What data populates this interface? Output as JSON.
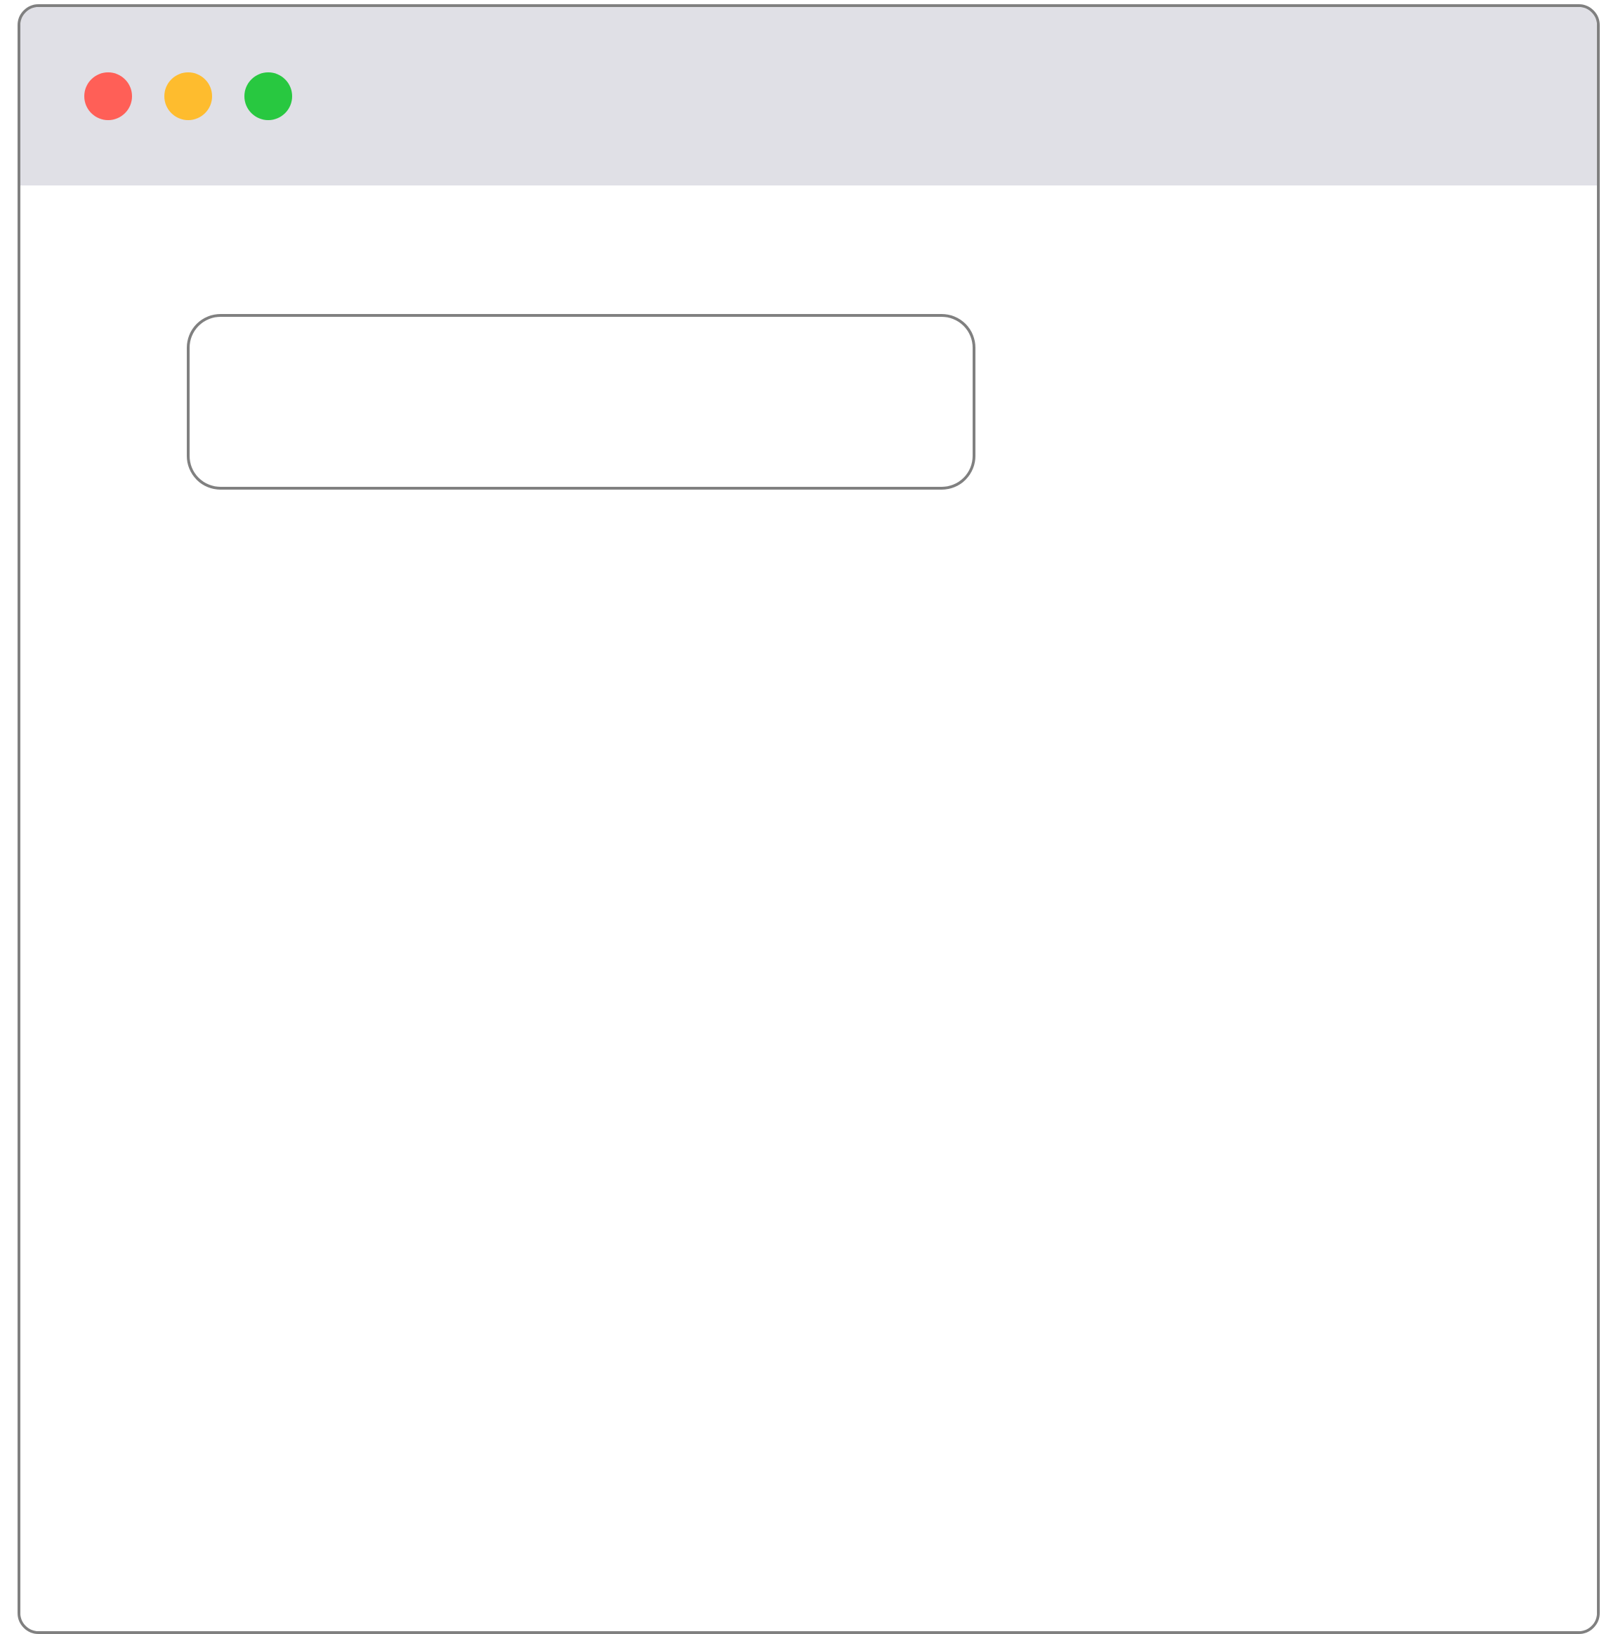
{
  "window": {
    "controls": {
      "close": {
        "icon": "close-dot-icon",
        "color": "#ff5f57"
      },
      "minimize": {
        "icon": "minimize-dot-icon",
        "color": "#febc2e"
      },
      "zoom": {
        "icon": "zoom-dot-icon",
        "color": "#28c840"
      }
    },
    "colors": {
      "titlebar": "#e0e0e6",
      "border": "#808080",
      "background": "#ffffff"
    }
  },
  "main": {
    "text_box": {
      "value": ""
    }
  }
}
